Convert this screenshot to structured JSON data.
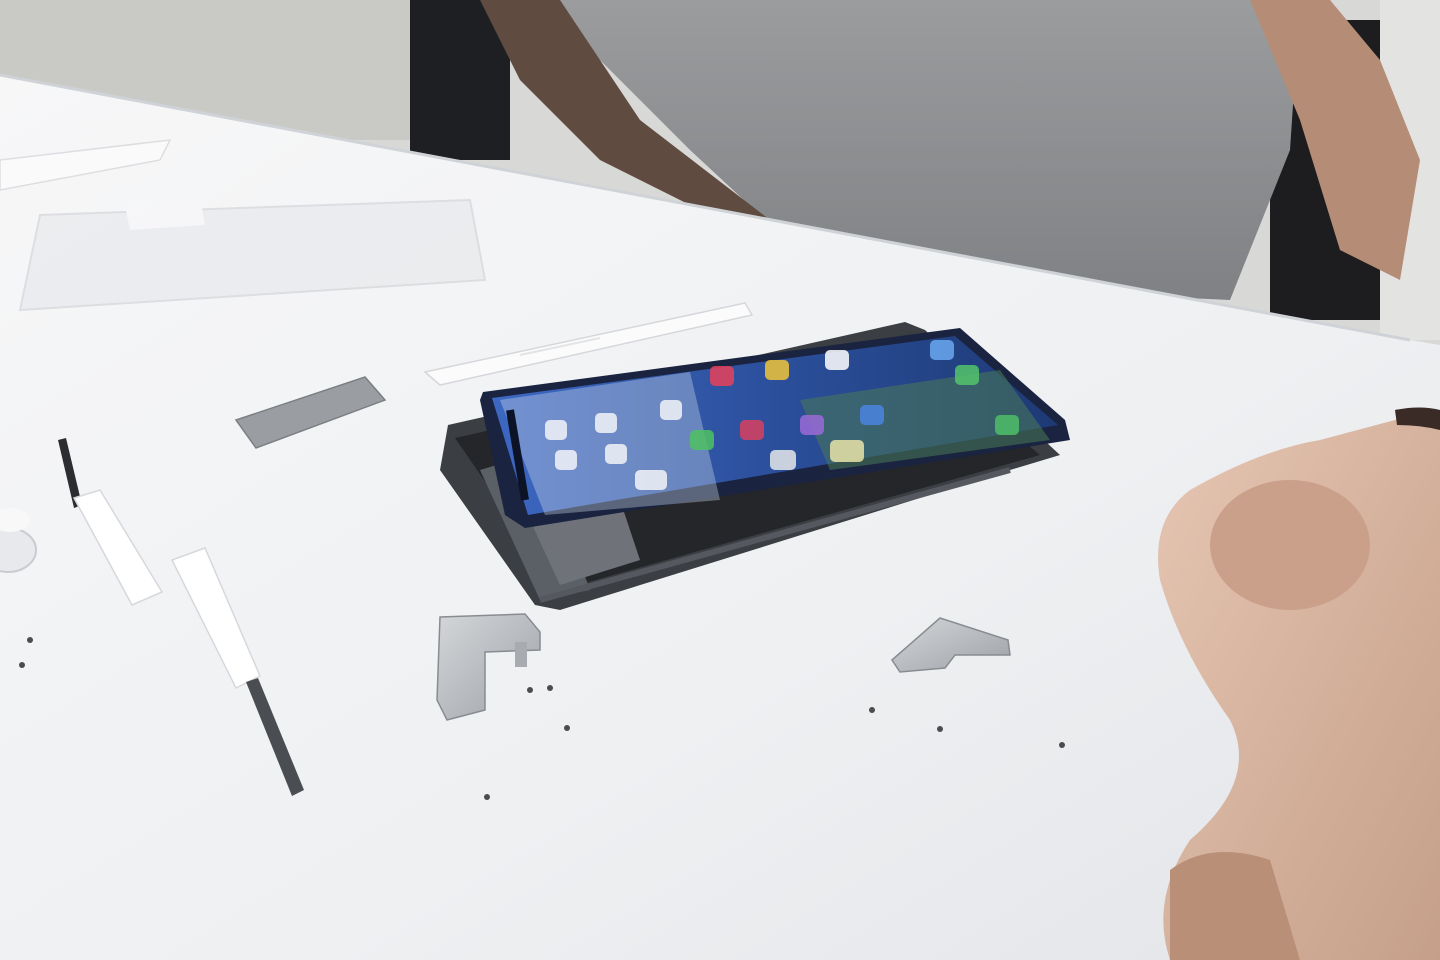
{
  "scene": {
    "palette": {
      "table_top": "#f1f2f4",
      "table_shadow": "#dfe1e5",
      "shirt": "#8e9092",
      "skin": "#d9b7a2",
      "chair": "#1d1d1f",
      "phone_frame": "#3a3d42",
      "screen_blue": "#2d57a8",
      "bracket_metal": "#b9bcc0"
    },
    "icons": [
      "person-torso",
      "disassembled-smartphone",
      "display-panel",
      "screwdriver",
      "metal-bracket",
      "suction-cup",
      "pry-tool",
      "hand"
    ]
  }
}
